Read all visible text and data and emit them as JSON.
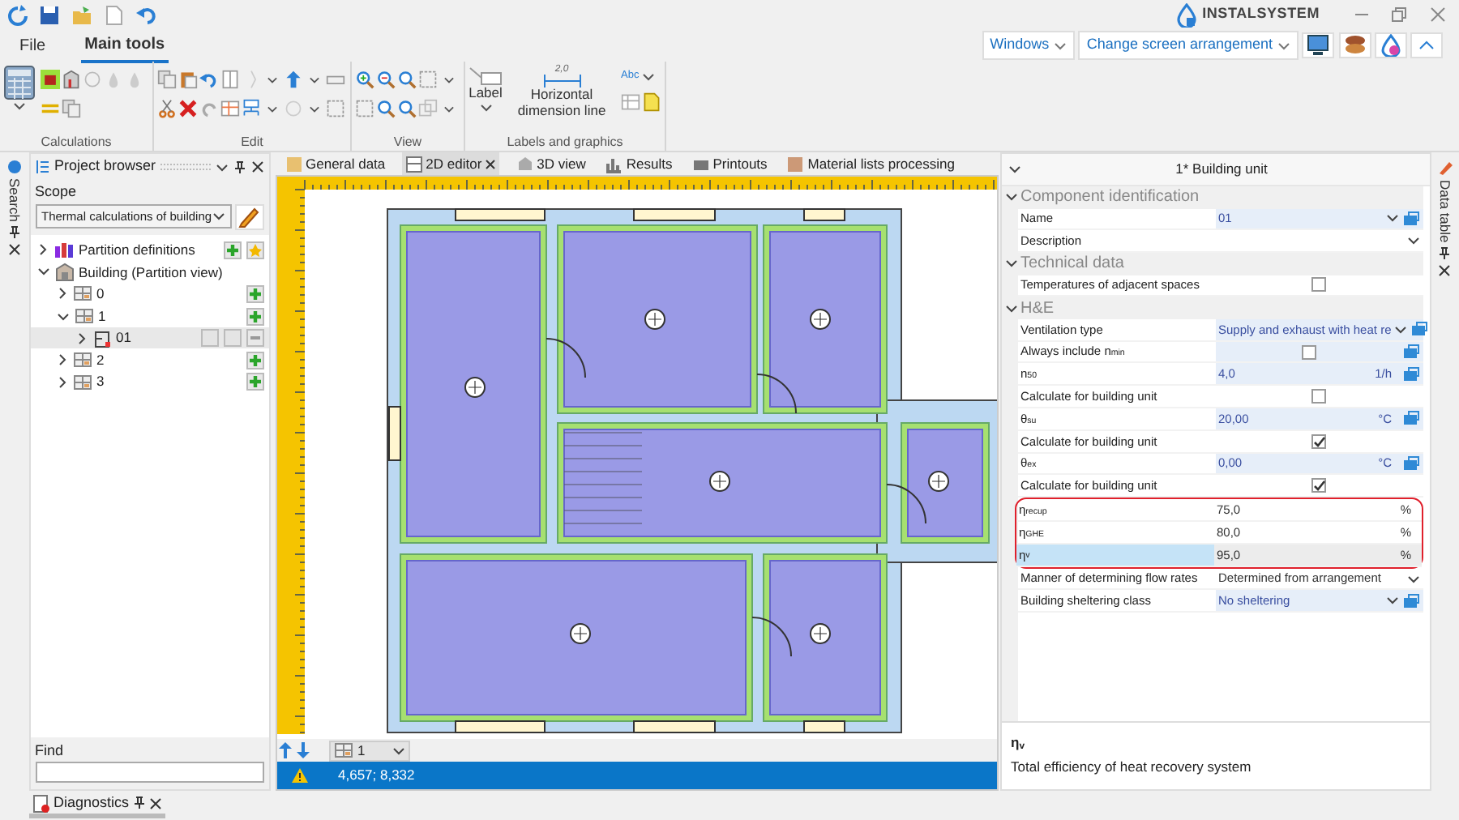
{
  "title_bar": {
    "logo_text": "INSTALSYSTEM"
  },
  "menu_tabs": [
    {
      "label": "File",
      "selected": false
    },
    {
      "label": "Main tools",
      "selected": true
    }
  ],
  "top_right": {
    "windows_menu": "Windows",
    "arrangement_menu": "Change screen arrangement"
  },
  "ribbon_groups": [
    {
      "label": "Calculations"
    },
    {
      "label": "Edit"
    },
    {
      "label": "View"
    },
    {
      "label": "Labels and graphics"
    }
  ],
  "ribbon_buttons": {
    "label_button": "Label",
    "dimension_button": "Horizontal dimension line",
    "dimension_value": "2,0",
    "text_style": "Abc"
  },
  "side_tabs": {
    "left": "Search",
    "right": "Data table"
  },
  "project_browser": {
    "title": "Project browser",
    "scope_label": "Scope",
    "scope_value": "Thermal calculations of building",
    "find_label": "Find",
    "tree": [
      {
        "label": "Partition definitions",
        "kind": "definitions",
        "expanded": false,
        "selected": false
      },
      {
        "label": "Building (Partition view)",
        "kind": "building",
        "expanded": true,
        "selected": false,
        "children": [
          {
            "label": "0",
            "kind": "level",
            "expanded": false,
            "selected": false
          },
          {
            "label": "1",
            "kind": "level",
            "expanded": true,
            "selected": false,
            "children": [
              {
                "label": "01",
                "kind": "unit",
                "expanded": false,
                "selected": true
              }
            ]
          },
          {
            "label": "2",
            "kind": "level",
            "expanded": false,
            "selected": false
          },
          {
            "label": "3",
            "kind": "level",
            "expanded": false,
            "selected": false
          }
        ]
      }
    ]
  },
  "editor_tabs": [
    {
      "label": "General data",
      "selected": false
    },
    {
      "label": "2D editor",
      "selected": true
    },
    {
      "label": "3D view",
      "selected": false
    },
    {
      "label": "Results",
      "selected": false
    },
    {
      "label": "Printouts",
      "selected": false
    },
    {
      "label": "Material lists processing",
      "selected": false
    }
  ],
  "level_selector": "1",
  "status_bar": {
    "coordinates": "4,657; 8,332"
  },
  "properties": {
    "title": "1* Building unit",
    "sections": [
      {
        "title": "Component identification",
        "expanded": true,
        "rows": [
          {
            "label": "Name",
            "kind": "value",
            "value": "01",
            "dropdown": true,
            "linked": true,
            "highlighted": false,
            "selected": false
          },
          {
            "label": "Description",
            "kind": "value",
            "dropdown": true,
            "linked": false,
            "highlighted": false,
            "selected": false
          }
        ]
      },
      {
        "title": "Technical data",
        "expanded": true,
        "rows": [
          {
            "label": "Temperatures of adjacent spaces",
            "kind": "checkbox",
            "checked": false,
            "linked": false,
            "highlighted": false,
            "selected": false
          }
        ]
      },
      {
        "title": "H&E",
        "expanded": true,
        "rows": [
          {
            "label": "Ventilation type",
            "kind": "value",
            "value": "Supply and exhaust with heat re",
            "dropdown": true,
            "linked": true,
            "highlighted": false,
            "selected": false
          },
          {
            "label": "Always include n$_{min}$",
            "kind": "checkbox",
            "checked": false,
            "linked": true,
            "highlighted": false,
            "selected": false
          },
          {
            "label": "n$_{50}$",
            "kind": "value",
            "value": "4,0",
            "unit": "1/h",
            "dropdown": false,
            "linked": true,
            "highlighted": false,
            "selected": false
          },
          {
            "label": "Calculate for building unit",
            "kind": "checkbox",
            "checked": false,
            "linked": false,
            "highlighted": false,
            "selected": false
          },
          {
            "label": "θ$_{su}$",
            "kind": "value",
            "value": "20,00",
            "unit": "°C",
            "dropdown": false,
            "linked": true,
            "highlighted": false,
            "selected": false
          },
          {
            "label": "Calculate for building unit",
            "kind": "checkbox",
            "checked": true,
            "linked": false,
            "highlighted": false,
            "selected": false
          },
          {
            "label": "θ$_{ex}$",
            "kind": "value",
            "value": "0,00",
            "unit": "°C",
            "dropdown": false,
            "linked": true,
            "highlighted": false,
            "selected": false
          },
          {
            "label": "Calculate for building unit",
            "kind": "checkbox",
            "checked": true,
            "linked": false,
            "highlighted": false,
            "selected": false
          },
          {
            "label": "η$_{recup}$",
            "kind": "value",
            "value": "75,0",
            "unit": "%",
            "dropdown": false,
            "linked": false,
            "highlighted": true,
            "selected": false
          },
          {
            "label": "η$_{GHE}$",
            "kind": "value",
            "value": "80,0",
            "unit": "%",
            "dropdown": false,
            "linked": false,
            "highlighted": true,
            "selected": false
          },
          {
            "label": "η$_{v}$",
            "kind": "value",
            "value": "95,0",
            "unit": "%",
            "dropdown": false,
            "linked": false,
            "highlighted": true,
            "selected": true
          },
          {
            "label": "Manner of determining flow rates",
            "kind": "value",
            "value": "Determined from arrangement",
            "dropdown": true,
            "linked": false,
            "highlighted": false,
            "selected": false
          },
          {
            "label": "Building sheltering class",
            "kind": "value",
            "value": "No sheltering",
            "dropdown": true,
            "linked": true,
            "highlighted": false,
            "selected": false
          }
        ]
      }
    ],
    "description_title": "η$_{v}$",
    "description": "Total efficiency of heat recovery system"
  },
  "diagnostics_tab": "Diagnostics"
}
